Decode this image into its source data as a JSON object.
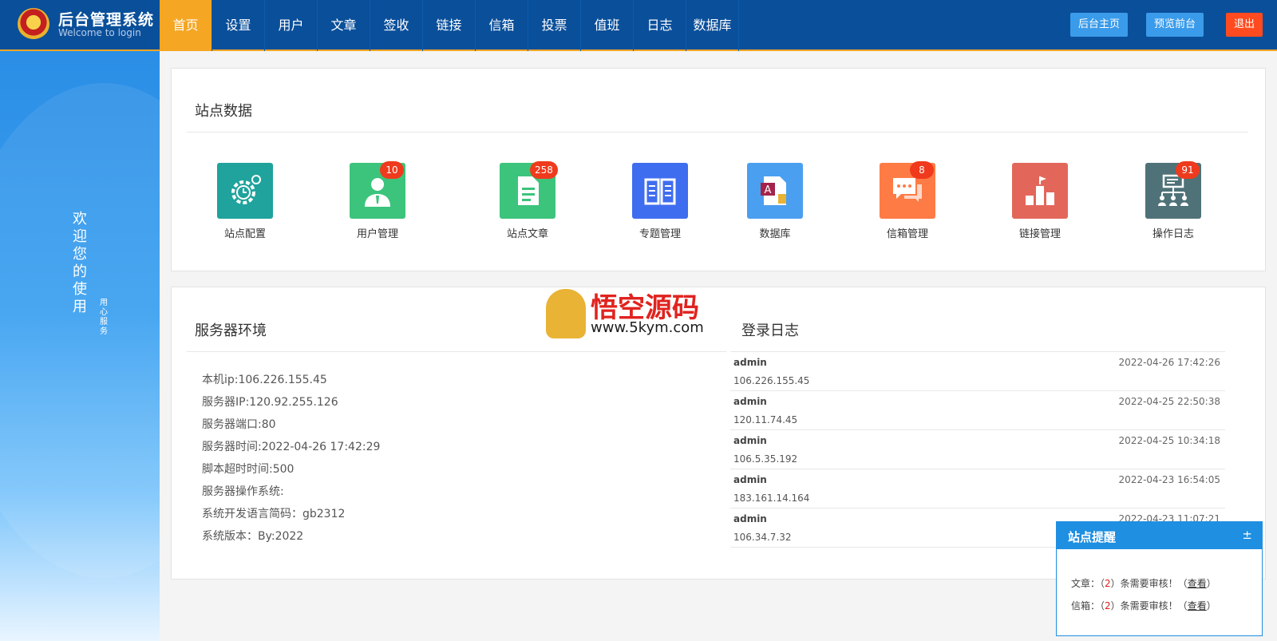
{
  "header": {
    "title": "后台管理系统",
    "subtitle": "Welcome to login",
    "nav": [
      "首页",
      "设置",
      "用户",
      "文章",
      "签收",
      "链接",
      "信箱",
      "投票",
      "值班",
      "日志",
      "数据库"
    ],
    "active_nav": "首页",
    "buttons": {
      "home": "后台主页",
      "preview": "预览前台",
      "logout": "退出"
    }
  },
  "sidebar": {
    "welcome": "欢迎您的使用",
    "slogan": "用心服务"
  },
  "site_data": {
    "title": "站点数据",
    "items": [
      {
        "label": "站点配置",
        "badge": "",
        "color": "#1fa39c",
        "icon": "gear-clock-icon"
      },
      {
        "label": "用户管理",
        "badge": "10",
        "color": "#3cc47c",
        "icon": "user-icon"
      },
      {
        "label": "站点文章",
        "badge": "258",
        "color": "#3cc47c",
        "icon": "document-icon"
      },
      {
        "label": "专题管理",
        "badge": "",
        "color": "#3f6df0",
        "icon": "book-icon"
      },
      {
        "label": "数据库",
        "badge": "",
        "color": "#4a9ff0",
        "icon": "database-file-icon"
      },
      {
        "label": "信箱管理",
        "badge": "8",
        "color": "#fe7b45",
        "icon": "chat-icon"
      },
      {
        "label": "链接管理",
        "badge": "",
        "color": "#e2675a",
        "icon": "flag-chart-icon"
      },
      {
        "label": "操作日志",
        "badge": "91",
        "color": "#4f7278",
        "icon": "org-chart-icon"
      }
    ]
  },
  "server_env": {
    "title": "服务器环境",
    "lines": [
      "本机ip:106.226.155.45",
      "服务器IP:120.92.255.126",
      "服务器端口:80",
      "服务器时间:2022-04-26 17:42:29",
      "脚本超时时间:500",
      "服务器操作系统:",
      "系统开发语言简码：gb2312",
      "系统版本：By:2022"
    ]
  },
  "watermark": {
    "title": "悟空源码",
    "url": "www.5kym.com"
  },
  "login_log": {
    "title": "登录日志",
    "rows": [
      {
        "user": "admin",
        "time": "2022-04-26 17:42:26",
        "ip": "106.226.155.45"
      },
      {
        "user": "admin",
        "time": "2022-04-25 22:50:38",
        "ip": "120.11.74.45"
      },
      {
        "user": "admin",
        "time": "2022-04-25 10:34:18",
        "ip": "106.5.35.192"
      },
      {
        "user": "admin",
        "time": "2022-04-23 16:54:05",
        "ip": "183.161.14.164"
      },
      {
        "user": "admin",
        "time": "2022-04-23 11:07:21",
        "ip": "106.34.7.32"
      }
    ]
  },
  "reminder": {
    "title": "站点提醒",
    "toggle": "±",
    "lines": [
      {
        "label": "文章：",
        "open": "（",
        "count": "2",
        "text": "）条需要审核！（",
        "link": "查看",
        "close": "）"
      },
      {
        "label": "信箱：",
        "open": "（",
        "count": "2",
        "text": "）条需要审核！（",
        "link": "查看",
        "close": "）"
      }
    ]
  }
}
